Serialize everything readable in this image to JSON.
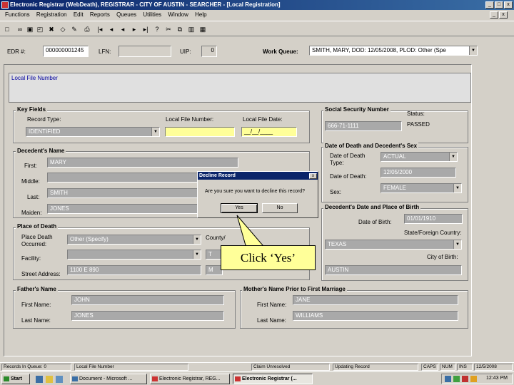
{
  "app": {
    "title": "Electronic Registrar (WebDeath), REGISTRAR - CITY OF AUSTIN - SEARCHER - [Local Registration]"
  },
  "window_controls": [
    "_",
    "□",
    "x"
  ],
  "menu": [
    "Functions",
    "Registration",
    "Edit",
    "Reports",
    "Queues",
    "Utilities",
    "Window",
    "Help"
  ],
  "toolbar_icons": [
    "new-icon",
    "binoculars-icon",
    "save-icon",
    "print-preview-icon",
    "delete-icon",
    "tag-icon",
    "print-icon",
    "first-record-icon",
    "prev-record-icon",
    "next-record-icon",
    "last-record-icon",
    "help-icon",
    "cut-icon",
    "copy-icon",
    "book-icon",
    "grid-icon"
  ],
  "header": {
    "edr_label": "EDR #:",
    "edr_value": "000000001245",
    "lfn_label": "LFN:",
    "lfn_value": "",
    "uip_label": "UIP:",
    "uip_value": "0",
    "work_queue_label": "Work Queue:",
    "work_queue_value": "SMITH, MARY, DOD: 12/05/2008, PLOD: Other (Spe"
  },
  "local_file_number_label": "Local File Number",
  "key_fields": {
    "title": "Key Fields",
    "record_type_label": "Record Type:",
    "record_type_value": "IDENTIFIED",
    "lfn_label": "Local File Number:",
    "lfn_value": "",
    "lfd_label": "Local File Date:",
    "lfd_value": "__/__/____"
  },
  "ssn": {
    "title": "Social Security Number",
    "value": "666-71-1111",
    "status_label": "Status:",
    "status_value": "PASSED"
  },
  "decedent_name": {
    "title": "Decedent's Name",
    "first_label": "First:",
    "first_value": "MARY",
    "middle_label": "Middle:",
    "middle_value": "",
    "last_label": "Last:",
    "last_value": "SMITH",
    "maiden_label": "Maiden:",
    "maiden_value": "JONES"
  },
  "date_of_death": {
    "title": "Date of Death and Decedent's Sex",
    "type_label": "Date of Death Type:",
    "type_value": "ACTUAL",
    "date_label": "Date of Death:",
    "date_value": "12/05/2000",
    "sex_label": "Sex:",
    "sex_value": "FEMALE"
  },
  "birth": {
    "title": "Decedent's Date and Place of Birth",
    "dob_label": "Date of Birth:",
    "dob_value": "01/01/1910",
    "state_label": "State/Foreign Country:",
    "state_value": "TEXAS",
    "city_label": "City of Birth:",
    "city_value": "AUSTIN"
  },
  "place_of_death": {
    "title": "Place of Death",
    "place_label": "Place Death Occurred:",
    "place_value": "Other (Specify)",
    "facility_label": "Facility:",
    "facility_value": "",
    "street_label": "Street Address:",
    "street_value": "1100 E 890",
    "county_label": "County/",
    "county_value": "T",
    "city_value": "M"
  },
  "father": {
    "title": "Father's Name",
    "first_label": "First Name:",
    "first_value": "JOHN",
    "last_label": "Last Name:",
    "last_value": "JONES"
  },
  "mother": {
    "title": "Mother's Name Prior to First Marriage",
    "first_label": "First Name:",
    "first_value": "JANE",
    "last_label": "Last Name:",
    "last_value": "WILLIAMS"
  },
  "dialog": {
    "title": "Decline Record",
    "message": "Are you sure you want to decline this record?",
    "yes": "Yes",
    "no": "No",
    "close": "x"
  },
  "callout": "Click ‘Yes’",
  "statusbar": {
    "records": "Records In Queue: 0",
    "lfn": "Local File Number",
    "claim": "Claim Unresolved",
    "updating": "Updating Record",
    "caps": "CAPS",
    "num": "NUM",
    "ins": "INS",
    "date": "12/5/2008"
  },
  "taskbar": {
    "start": "Start",
    "tasks": [
      "Document - Microsoft ...",
      "Electronic Registrar, REG...",
      "Electronic Registrar (..."
    ],
    "clock": "12:43 PM"
  }
}
